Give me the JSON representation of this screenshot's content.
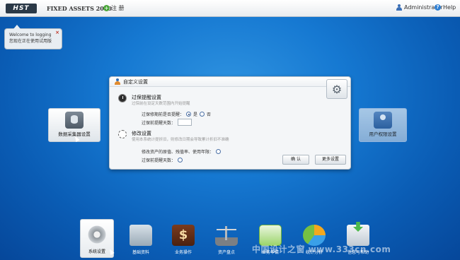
{
  "topbar": {
    "logo": "HST",
    "app_title": "FIXED ASSETS 2010",
    "register_icon": "green-plus-icon",
    "register_label": "注 册",
    "user_label": "Administrator",
    "help_label": "Help"
  },
  "welcome": {
    "line1": "Welcome to logging",
    "line2": "您现在正在使用试用版",
    "close": "×"
  },
  "tiles": {
    "left_label": "数据采集器设置",
    "right_label": "用户权限设置"
  },
  "dialog": {
    "title": "自定义设置",
    "section1": {
      "title": "过保提醒设置",
      "subtitle": "过保前在设定天数范围内开始提醒",
      "q1": "过保修期前是否提醒：",
      "opt_yes": "是",
      "opt_no": "否",
      "q2": "过保前提醒天数："
    },
    "section2": {
      "title": "修改设置",
      "subtitle": "使用本系统计提折旧，则修改日期会导致累计折旧不准确",
      "q1": "修改资产的原值、残值率、使用年限：",
      "q2": "过保前提醒天数："
    },
    "btn_ok": "确 认",
    "btn_more": "更多设置"
  },
  "dock": [
    {
      "label": "系统设置",
      "icon": "gear-icon"
    },
    {
      "label": "基础资料",
      "icon": "folder-icon"
    },
    {
      "label": "业务操作",
      "icon": "money-icon"
    },
    {
      "label": "资产盘点",
      "icon": "scale-icon"
    },
    {
      "label": "业务申请",
      "icon": "notepad-icon"
    },
    {
      "label": "统计分析",
      "icon": "pie-chart-icon"
    },
    {
      "label": "信息与帮助",
      "icon": "download-box-icon"
    }
  ],
  "watermark": "中国设计之窗 www.333cn.com",
  "colors": {
    "background": "#1679d2",
    "dialog_bg": "#f4f6f8",
    "accent_green": "#4aa63a"
  }
}
